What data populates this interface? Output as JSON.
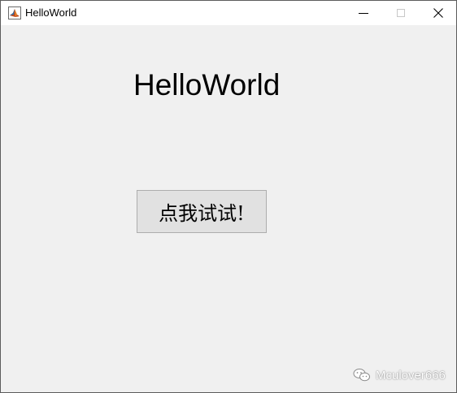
{
  "window": {
    "title": "HelloWorld",
    "app_icon": "matlab-logo-icon",
    "controls": {
      "minimize": "minimize-icon",
      "maximize": "maximize-icon",
      "close": "close-icon"
    }
  },
  "main": {
    "label_text": "HelloWorld",
    "button_label": "点我试试!"
  },
  "watermark": {
    "icon": "wechat-icon",
    "text": "Mculover666"
  },
  "colors": {
    "window_background": "#f0f0f0",
    "titlebar_background": "#ffffff",
    "button_background": "#e1e1e1",
    "button_border": "#adadad"
  }
}
